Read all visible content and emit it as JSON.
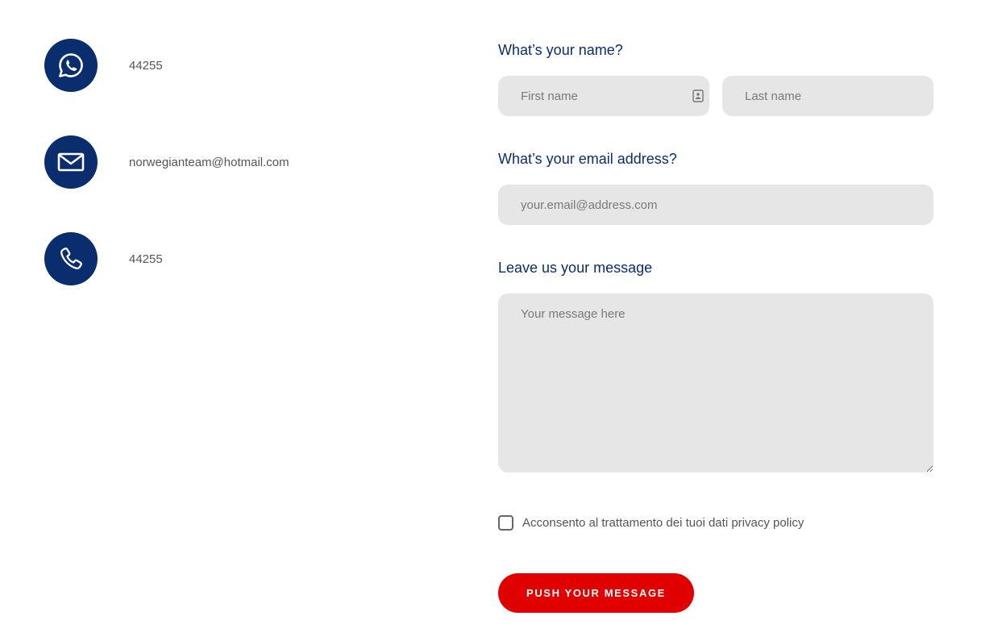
{
  "contacts": {
    "whatsapp": {
      "icon": "whatsapp-icon",
      "text": "44255"
    },
    "email": {
      "icon": "envelope-icon",
      "text": "norwegianteam@hotmail.com"
    },
    "phone": {
      "icon": "phone-icon",
      "text": "44255"
    }
  },
  "form": {
    "name_label": "What’s your name?",
    "first_name_placeholder": "First name",
    "last_name_placeholder": "Last name",
    "email_label": "What’s your email address?",
    "email_placeholder": "your.email@address.com",
    "message_label": "Leave us your message",
    "message_placeholder": "Your message here",
    "consent_text": "Acconsento al trattamento dei tuoi dati privacy policy",
    "submit_label": "PUSH YOUR MESSAGE"
  },
  "colors": {
    "brand_navy": "#0a2d6e",
    "accent_red": "#e00000",
    "field_bg": "#e6e6e6"
  }
}
